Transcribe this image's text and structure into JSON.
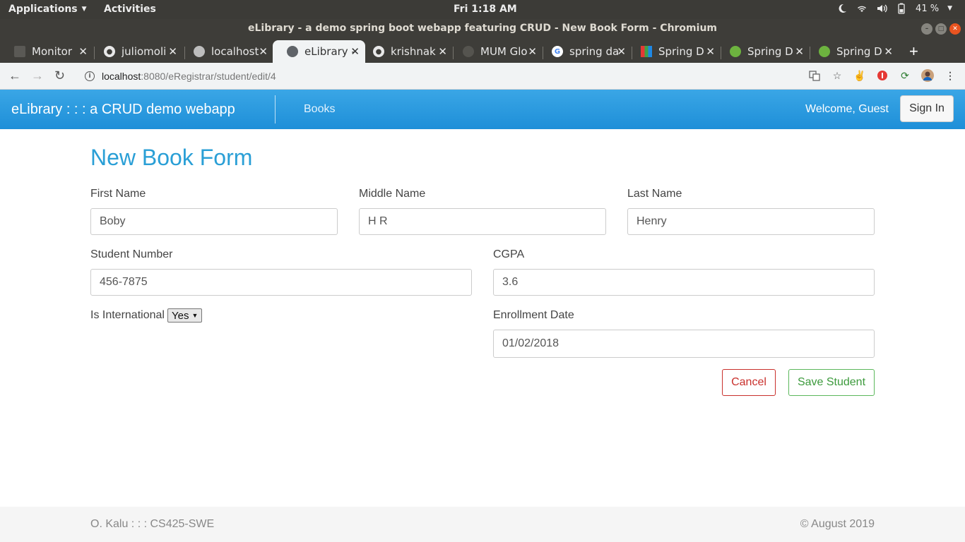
{
  "os": {
    "applications": "Applications",
    "activities": "Activities",
    "clock": "Fri  1:18 AM",
    "battery": "41 %"
  },
  "window": {
    "title": "eLibrary - a demo spring boot webapp featuring CRUD - New Book Form - Chromium"
  },
  "tabs": [
    {
      "label": "Monitor",
      "favicon": "folder-icon"
    },
    {
      "label": "juliomoli",
      "favicon": "github-icon"
    },
    {
      "label": "localhost",
      "favicon": "globe-icon"
    },
    {
      "label": "eLibrary -",
      "favicon": "globe-icon",
      "active": true
    },
    {
      "label": "krishnak",
      "favicon": "github-icon"
    },
    {
      "label": "MUM Glo",
      "favicon": "globe-icon"
    },
    {
      "label": "spring da",
      "favicon": "google-icon"
    },
    {
      "label": "Spring D",
      "favicon": "grid-icon"
    },
    {
      "label": "Spring D",
      "favicon": "spring-icon"
    },
    {
      "label": "Spring D",
      "favicon": "spring-icon"
    }
  ],
  "address": {
    "host": "localhost",
    "path": ":8080/eRegistrar/student/edit/4"
  },
  "navbar": {
    "brand": "eLibrary : : : a CRUD demo webapp",
    "books_link": "Books",
    "welcome": "Welcome, Guest",
    "signin": "Sign In"
  },
  "form": {
    "title": "New Book Form",
    "first_name": {
      "label": "First Name",
      "value": "Boby"
    },
    "middle_name": {
      "label": "Middle Name",
      "value": "H R"
    },
    "last_name": {
      "label": "Last Name",
      "value": "Henry"
    },
    "student_number": {
      "label": "Student Number",
      "value": "456-7875"
    },
    "cgpa": {
      "label": "CGPA",
      "value": "3.6"
    },
    "is_international": {
      "label": "Is International",
      "value": "Yes"
    },
    "enrollment_date": {
      "label": "Enrollment Date",
      "value": "01/02/2018"
    },
    "cancel": "Cancel",
    "save": "Save Student"
  },
  "footer": {
    "left": "O. Kalu : : : CS425-SWE",
    "right": "© August 2019"
  },
  "colors": {
    "navbar": "#2196e3",
    "title": "#2a9fd6",
    "cancel": "#c9302c",
    "save": "#5cb85c"
  }
}
